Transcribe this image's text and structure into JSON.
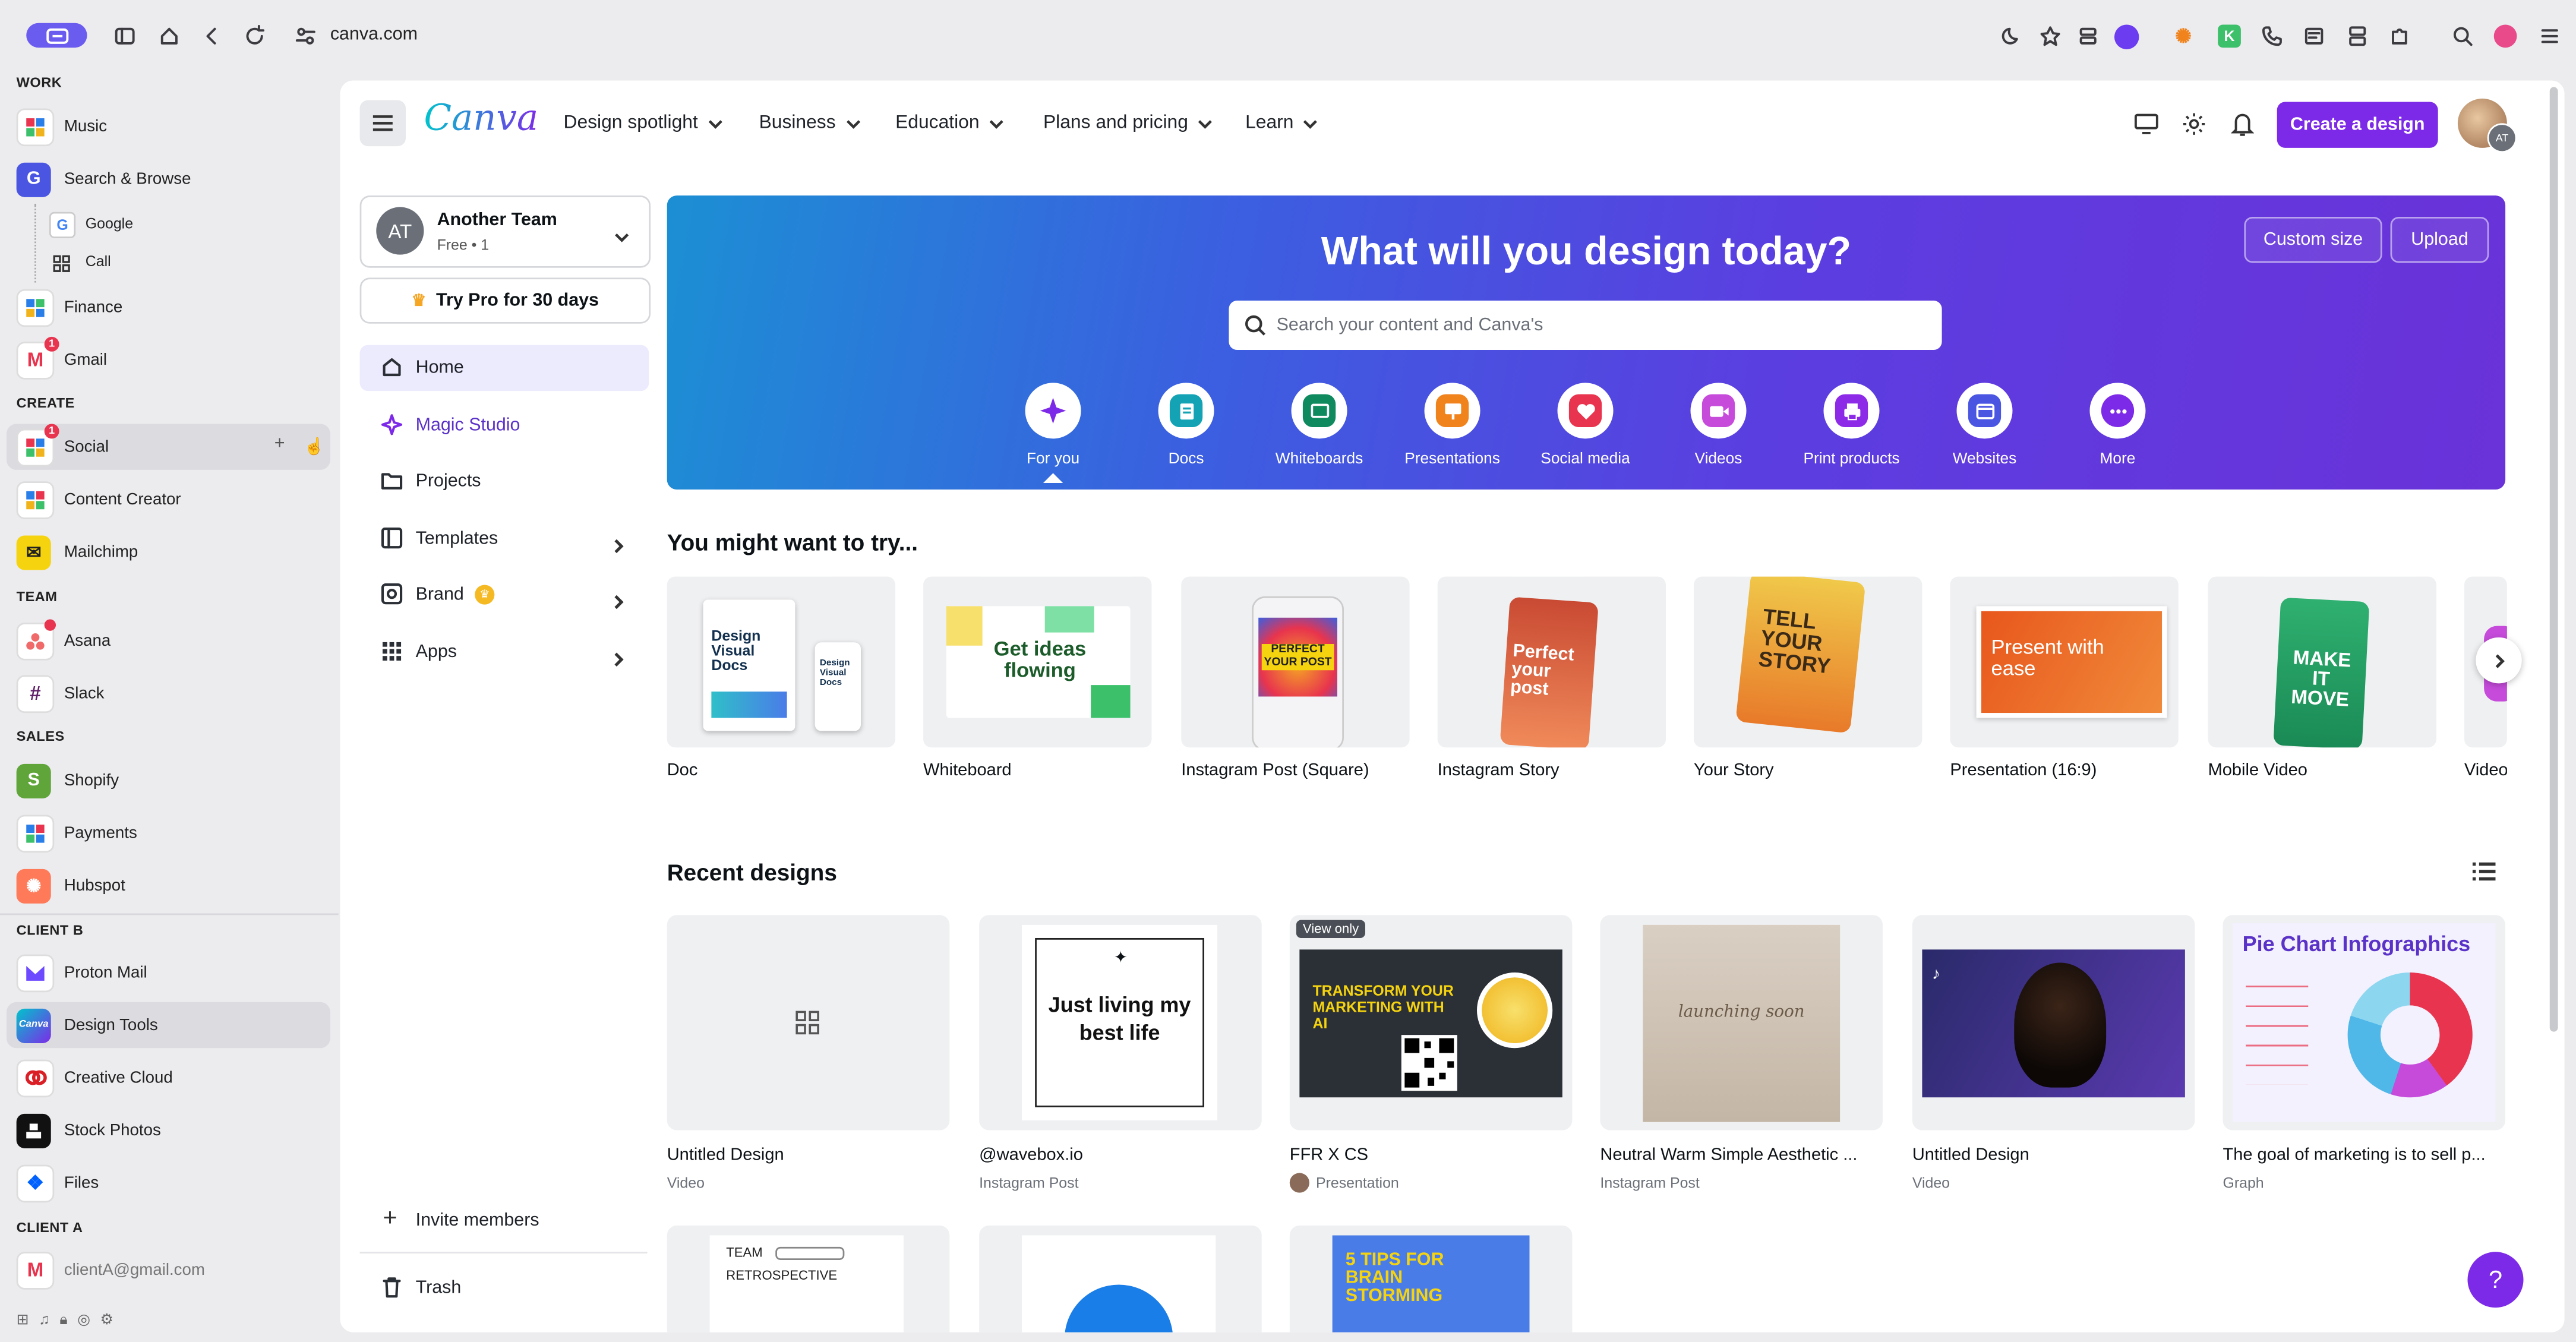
{
  "browser": {
    "url": "canva.com"
  },
  "sidebar": {
    "sections": {
      "work": "WORK",
      "create": "CREATE",
      "team": "TEAM",
      "sales": "SALES",
      "client_b": "CLIENT B",
      "client_a": "CLIENT A"
    },
    "items": {
      "music": "Music",
      "search_browse": "Search & Browse",
      "google": "Google",
      "call": "Call",
      "finance": "Finance",
      "gmail": "Gmail",
      "gmail_badge": "1",
      "social": "Social",
      "social_badge": "1",
      "content_creator": "Content Creator",
      "mailchimp": "Mailchimp",
      "asana": "Asana",
      "slack": "Slack",
      "shopify": "Shopify",
      "payments": "Payments",
      "hubspot": "Hubspot",
      "proton_mail": "Proton Mail",
      "design_tools": "Design Tools",
      "creative_cloud": "Creative Cloud",
      "stock_photos": "Stock Photos",
      "files": "Files",
      "client_a_email": "clientA@gmail.com"
    }
  },
  "canva": {
    "logo": "Canva",
    "nav": [
      "Design spotlight",
      "Business",
      "Education",
      "Plans and pricing",
      "Learn"
    ],
    "create_button": "Create a design",
    "avatar_initials": "AT",
    "team": {
      "initials": "AT",
      "name": "Another Team",
      "meta": "Free • 1"
    },
    "try_pro": "Try Pro for 30 days",
    "left_nav": [
      "Home",
      "Magic Studio",
      "Projects",
      "Templates",
      "Brand",
      "Apps"
    ],
    "invite": "Invite members",
    "trash": "Trash",
    "hero": {
      "title": "What will you design today?",
      "search_placeholder": "Search your content and Canva's",
      "custom_size": "Custom size",
      "upload": "Upload",
      "categories": [
        {
          "label": "For you",
          "color": "#7d2ae8",
          "icon": "sparkle-icon"
        },
        {
          "label": "Docs",
          "color": "#13a3b5",
          "icon": "doc-icon"
        },
        {
          "label": "Whiteboards",
          "color": "#0f8a5f",
          "icon": "whiteboard-icon"
        },
        {
          "label": "Presentations",
          "color": "#f0831c",
          "icon": "presentation-icon"
        },
        {
          "label": "Social media",
          "color": "#e8344e",
          "icon": "heart-icon"
        },
        {
          "label": "Videos",
          "color": "#c64bdb",
          "icon": "video-icon"
        },
        {
          "label": "Print products",
          "color": "#8d2ae8",
          "icon": "print-icon"
        },
        {
          "label": "Websites",
          "color": "#4a56e2",
          "icon": "website-icon"
        },
        {
          "label": "More",
          "color": "#7d2ae8",
          "icon": "more-icon"
        }
      ]
    },
    "try_title": "You might want to try...",
    "templates": [
      "Doc",
      "Whiteboard",
      "Instagram Post (Square)",
      "Instagram Story",
      "Your Story",
      "Presentation (16:9)",
      "Mobile Video",
      "Video"
    ],
    "template_texts": {
      "doc": "Design Visual Docs",
      "doc_small": "Design Visual Docs",
      "whiteboard": "Get ideas flowing",
      "insta_post": "PERFECT YOUR POST",
      "insta_story": "Perfect your post",
      "your_story": "TELL YOUR STORY",
      "presentation": "Present with ease",
      "mobile_video": "MAKE IT MOVE"
    },
    "recent_title": "Recent designs",
    "view_only": "View only",
    "recent": [
      {
        "title": "Untitled Design",
        "type": "Video"
      },
      {
        "title": "@wavebox.io",
        "type": "Instagram Post"
      },
      {
        "title": "FFR X CS",
        "type": "Presentation"
      },
      {
        "title": "Neutral Warm Simple Aesthetic ...",
        "type": "Instagram Post"
      },
      {
        "title": "Untitled Design",
        "type": "Video"
      },
      {
        "title": "The goal of marketing is to sell p...",
        "type": "Graph"
      }
    ],
    "recent_texts": {
      "wavebox": "Just living my best life",
      "ffr": "TRANSFORM YOUR MARKETING WITH AI",
      "neutral": "launching soon",
      "pie": "Pie Chart Infographics",
      "team_retro": "TEAM",
      "team_retro2": "RETROSPECTIVE",
      "tips": "5 TIPS FOR BRAIN STORMING"
    },
    "help": "?"
  }
}
